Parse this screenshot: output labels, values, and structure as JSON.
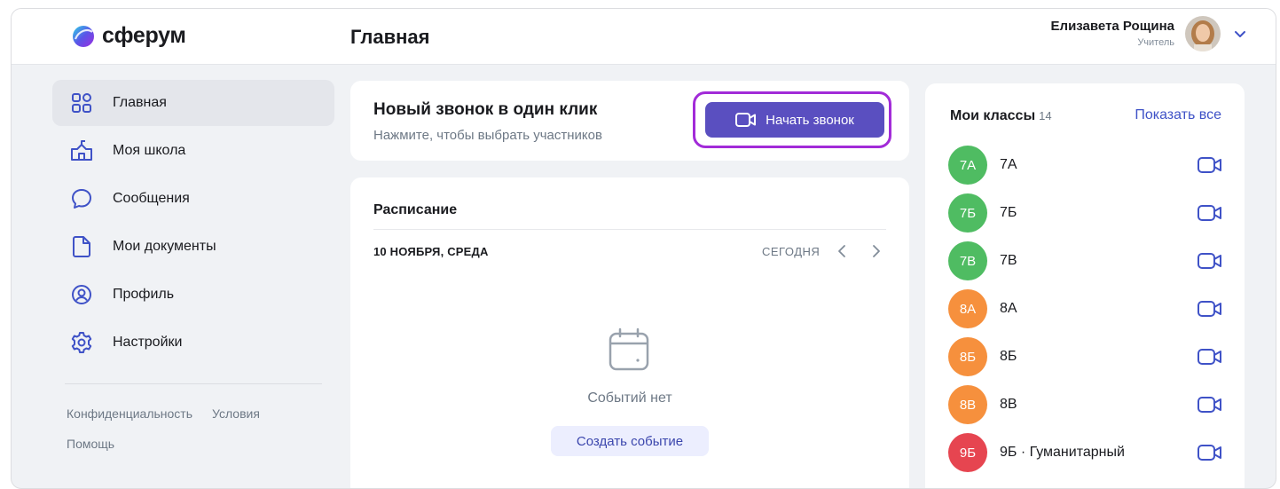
{
  "app": {
    "logo_text": "сферум"
  },
  "header": {
    "title": "Главная",
    "user_name": "Елизавета Рощина",
    "user_role": "Учитель"
  },
  "sidebar": {
    "items": [
      {
        "label": "Главная",
        "icon": "grid-icon",
        "active": true
      },
      {
        "label": "Моя школа",
        "icon": "school-icon",
        "active": false
      },
      {
        "label": "Сообщения",
        "icon": "message-icon",
        "active": false
      },
      {
        "label": "Мои документы",
        "icon": "document-icon",
        "active": false
      },
      {
        "label": "Профиль",
        "icon": "profile-icon",
        "active": false
      },
      {
        "label": "Настройки",
        "icon": "settings-icon",
        "active": false
      }
    ],
    "footer": {
      "privacy": "Конфиденциальность",
      "terms": "Условия",
      "help": "Помощь"
    }
  },
  "call_card": {
    "title": "Новый звонок в один клик",
    "subtitle": "Нажмите, чтобы выбрать участников",
    "button_label": "Начать звонок"
  },
  "schedule": {
    "title": "Расписание",
    "date": "10 НОЯБРЯ, СРЕДА",
    "today_label": "СЕГОДНЯ",
    "empty_text": "Событий нет",
    "create_label": "Создать событие"
  },
  "classes": {
    "title": "Мои классы",
    "count": "14",
    "show_all": "Показать все",
    "items": [
      {
        "badge": "7А",
        "name": "7А",
        "color": "#4fbc62"
      },
      {
        "badge": "7Б",
        "name": "7Б",
        "color": "#4fbc62"
      },
      {
        "badge": "7В",
        "name": "7В",
        "color": "#4fbc62"
      },
      {
        "badge": "8А",
        "name": "8А",
        "color": "#f6903d"
      },
      {
        "badge": "8Б",
        "name": "8Б",
        "color": "#f6903d"
      },
      {
        "badge": "8В",
        "name": "8В",
        "color": "#f6903d"
      },
      {
        "badge": "9Б",
        "name": "9Б · Гуманитарный",
        "color": "#e64550"
      }
    ]
  },
  "colors": {
    "accent": "#5a4fc0",
    "highlight": "#a22bd8",
    "link": "#3f52c7"
  }
}
